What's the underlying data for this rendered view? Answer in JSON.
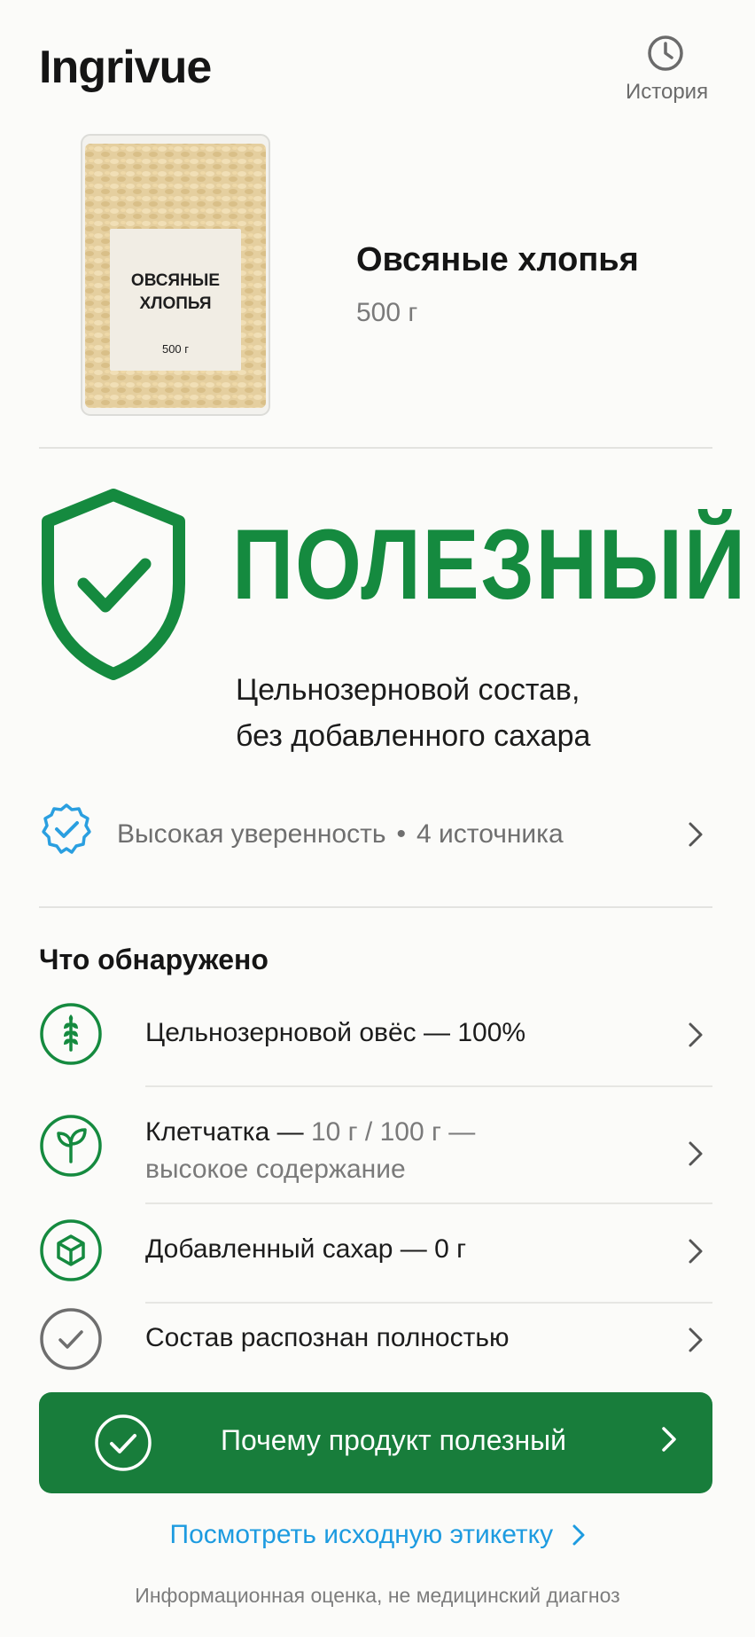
{
  "header": {
    "brand": "Ingrivue",
    "history_label": "История",
    "history_icon": "clock-icon"
  },
  "product": {
    "name": "Овсяные хлопья",
    "weight": "500 г",
    "pack_label_line1": "ОВСЯНЫЕ",
    "pack_label_line2": "ХЛОПЬЯ",
    "pack_weight": "500 г"
  },
  "verdict": {
    "title": "ПОЛЕЗНЫЙ",
    "description_line1": "Цельнозерновой состав,",
    "description_line2": "без добавленного сахара",
    "color": "#158a3f",
    "icon": "shield-check-icon"
  },
  "confidence": {
    "level": "Высокая уверенность",
    "separator": "•",
    "sources": "4 источника",
    "icon": "verified-badge-icon"
  },
  "findings": {
    "title": "Что обнаружено",
    "items": [
      {
        "text": "Цельнозерновой овёс — 100%",
        "icon": "wheat-icon"
      },
      {
        "text": "Клетчатка —",
        "muted": "10 г / 100 г —",
        "muted_line2": "высокое содержание",
        "icon": "sprout-icon"
      },
      {
        "text": "Добавленный сахар — 0 г",
        "icon": "sugar-cube-icon"
      },
      {
        "text": "Состав распознан полностью",
        "icon": "check-circle-icon"
      }
    ]
  },
  "cta": {
    "label": "Почему продукт полезный",
    "color": "#187d3b"
  },
  "links": {
    "source_label": "Посмотреть исходную этикетку",
    "disclaimer": "Информационная оценка, не медицинский диагноз"
  }
}
